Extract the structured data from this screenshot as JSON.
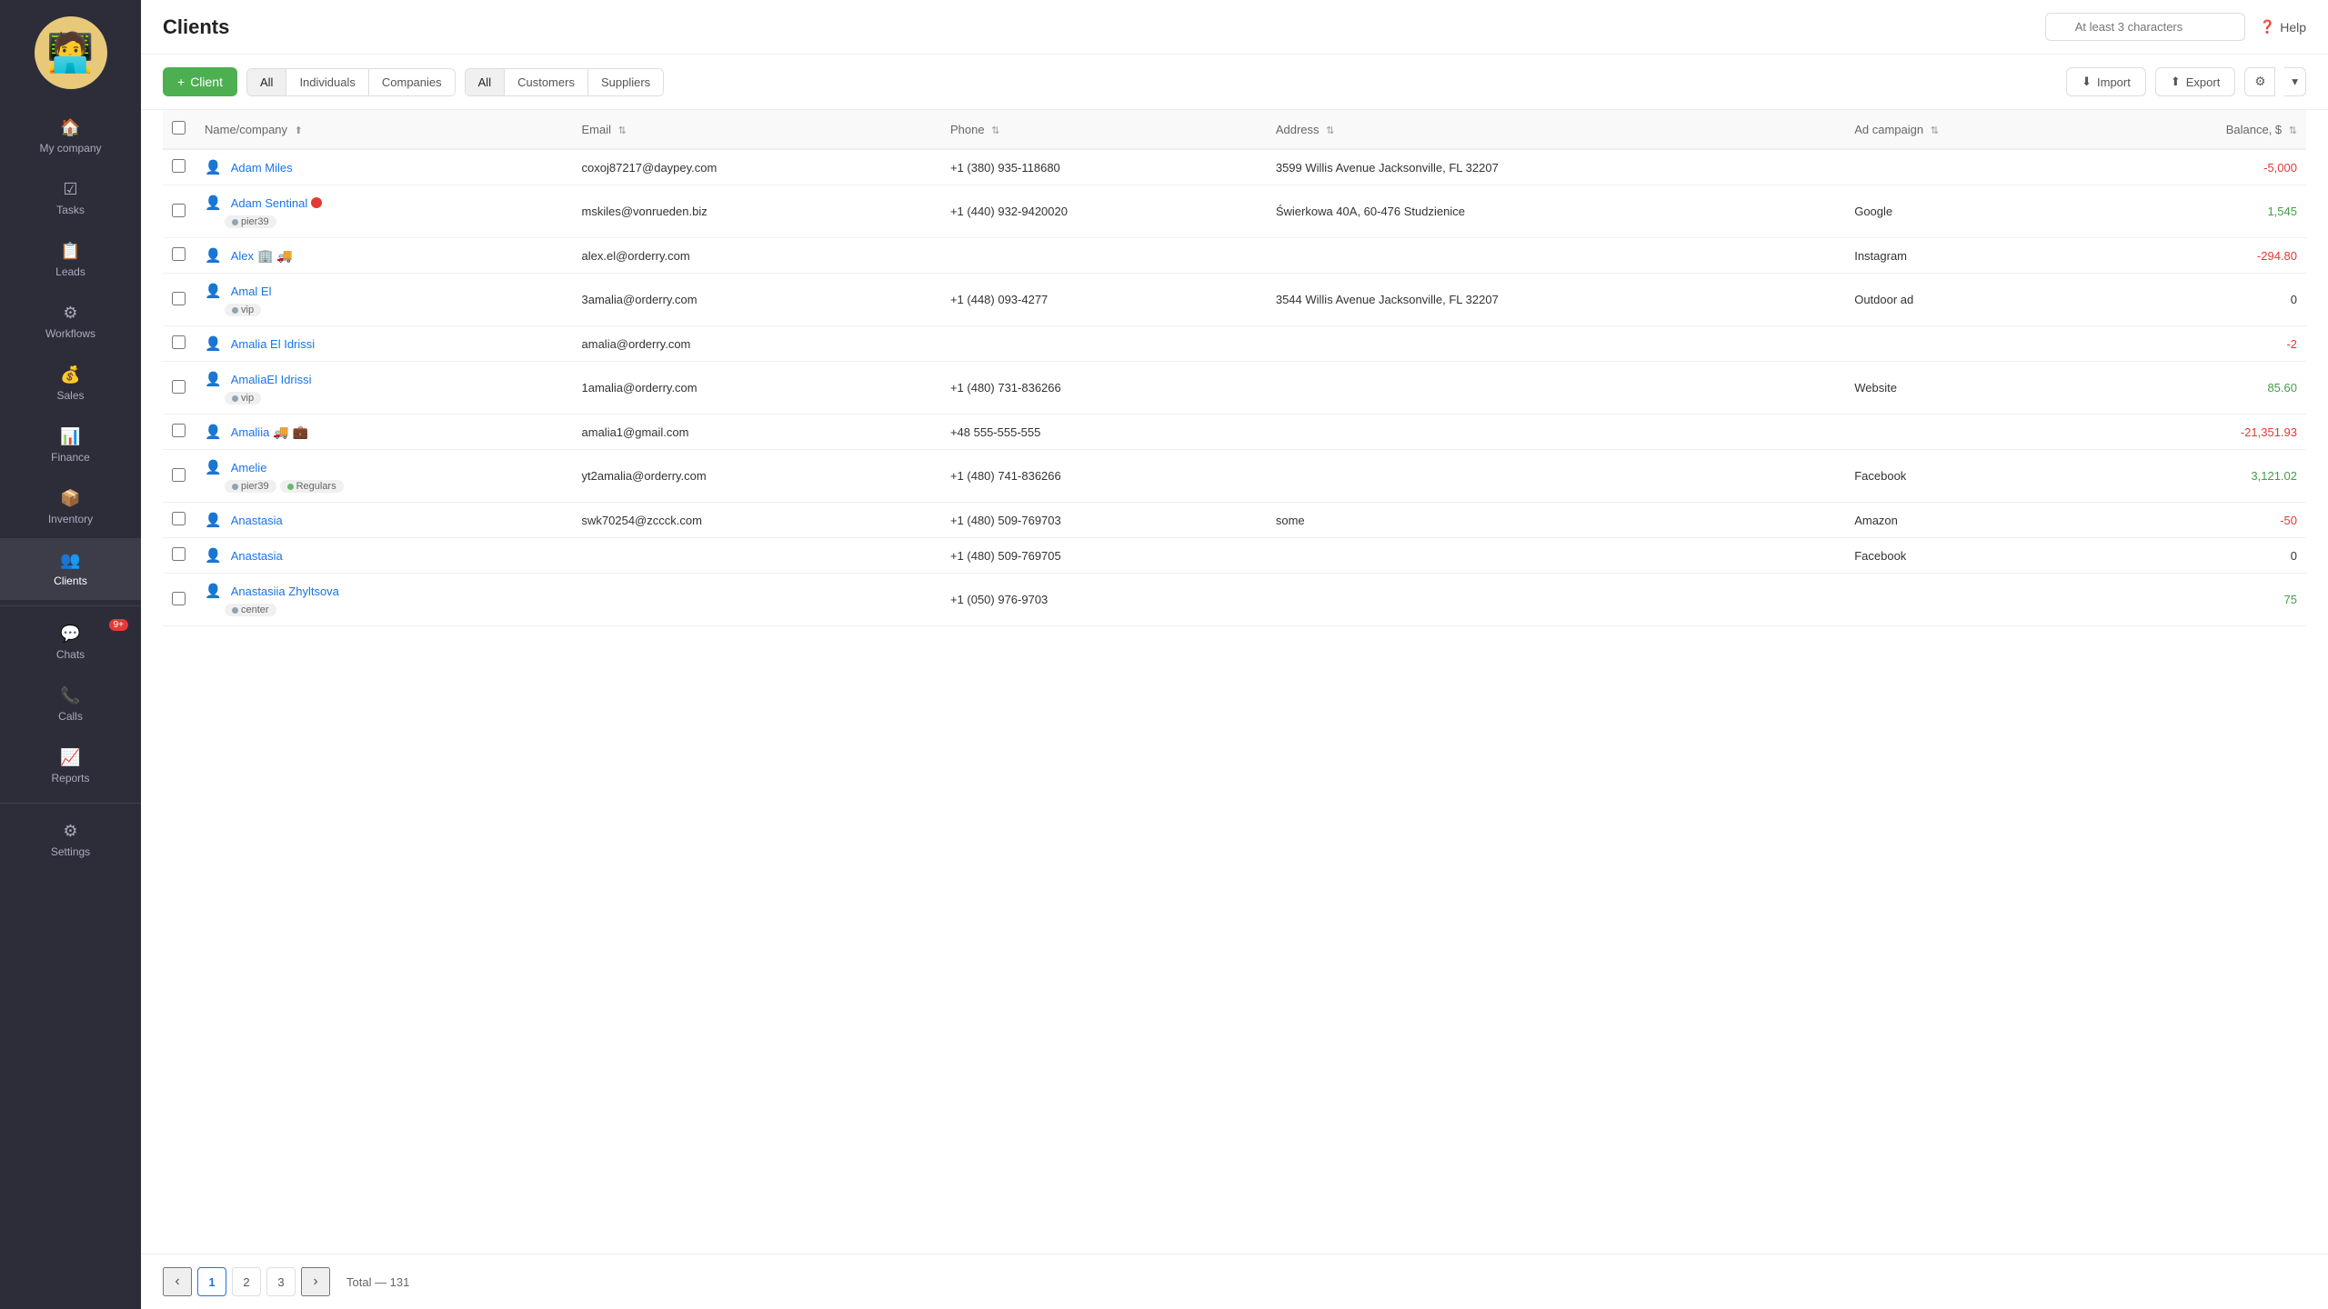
{
  "sidebar": {
    "items": [
      {
        "id": "my-company",
        "label": "My company",
        "icon": "🏠"
      },
      {
        "id": "tasks",
        "label": "Tasks",
        "icon": "✓"
      },
      {
        "id": "leads",
        "label": "Leads",
        "icon": "📋"
      },
      {
        "id": "workflows",
        "label": "Workflows",
        "icon": "⚙"
      },
      {
        "id": "sales",
        "label": "Sales",
        "icon": "💰"
      },
      {
        "id": "finance",
        "label": "Finance",
        "icon": "📊"
      },
      {
        "id": "inventory",
        "label": "Inventory",
        "icon": "📦"
      },
      {
        "id": "clients",
        "label": "Clients",
        "icon": "👥",
        "active": true
      },
      {
        "id": "chats",
        "label": "Chats",
        "icon": "💬",
        "badge": "9+"
      },
      {
        "id": "calls",
        "label": "Calls",
        "icon": "📞"
      },
      {
        "id": "reports",
        "label": "Reports",
        "icon": "📈"
      },
      {
        "id": "settings",
        "label": "Settings",
        "icon": "⚙"
      }
    ]
  },
  "header": {
    "title": "Clients",
    "search_placeholder": "At least 3 characters",
    "help_label": "Help"
  },
  "toolbar": {
    "add_button": "+ Client",
    "filter_groups": {
      "type_filters": [
        "All",
        "Individuals",
        "Companies"
      ],
      "role_filters": [
        "All",
        "Customers",
        "Suppliers"
      ]
    },
    "import_label": "Import",
    "export_label": "Export"
  },
  "table": {
    "columns": [
      {
        "id": "name",
        "label": "Name/company",
        "sortable": true
      },
      {
        "id": "email",
        "label": "Email",
        "sortable": true
      },
      {
        "id": "phone",
        "label": "Phone",
        "sortable": true
      },
      {
        "id": "address",
        "label": "Address",
        "sortable": true
      },
      {
        "id": "ad_campaign",
        "label": "Ad campaign",
        "sortable": true
      },
      {
        "id": "balance",
        "label": "Balance, $",
        "sortable": true
      }
    ],
    "rows": [
      {
        "id": 1,
        "name": "Adam Miles",
        "type": "individual",
        "email": "coxoj87217@daypey.com",
        "phone": "+1 (380) 935-118680",
        "address": "3599 Willis Avenue Jacksonville, FL 32207",
        "ad_campaign": "",
        "balance": "-5,000",
        "balance_type": "negative",
        "tags": [],
        "extra_icons": []
      },
      {
        "id": 2,
        "name": "Adam Sentinal",
        "type": "individual",
        "email": "mskiles@vonrueden.biz",
        "phone": "+1 (440) 932-9420020",
        "address": "Świerkowa 40A, 60-476 Studzienice",
        "ad_campaign": "Google",
        "balance": "1,545",
        "balance_type": "positive",
        "tags": [
          "pier39"
        ],
        "extra_icons": [
          "status-red"
        ],
        "tag_colors": [
          "gray"
        ]
      },
      {
        "id": 3,
        "name": "Alex",
        "type": "individual",
        "email": "alex.el@orderry.com",
        "phone": "",
        "address": "",
        "ad_campaign": "Instagram",
        "balance": "-294.80",
        "balance_type": "negative",
        "tags": [],
        "extra_icons": [
          "building",
          "truck"
        ]
      },
      {
        "id": 4,
        "name": "Amal El",
        "type": "individual",
        "email": "3amalia@orderry.com",
        "phone": "+1 (448) 093-4277",
        "address": "3544 Willis Avenue Jacksonville, FL 32207",
        "ad_campaign": "Outdoor ad",
        "balance": "0",
        "balance_type": "zero",
        "tags": [
          "vip"
        ],
        "tag_colors": [
          "gray"
        ]
      },
      {
        "id": 5,
        "name": "Amalia El Idrissi",
        "type": "individual",
        "email": "amalia@orderry.com",
        "phone": "",
        "address": "",
        "ad_campaign": "",
        "balance": "-2",
        "balance_type": "negative",
        "tags": [],
        "extra_icons": []
      },
      {
        "id": 6,
        "name": "AmaliaEl Idrissi",
        "type": "individual",
        "email": "1amalia@orderry.com",
        "phone": "+1 (480) 731-836266",
        "address": "",
        "ad_campaign": "Website",
        "balance": "85.60",
        "balance_type": "positive",
        "tags": [
          "vip"
        ],
        "tag_colors": [
          "gray"
        ]
      },
      {
        "id": 7,
        "name": "Amaliia",
        "type": "individual",
        "email": "amalia1@gmail.com",
        "phone": "+48 555-555-555",
        "address": "",
        "ad_campaign": "",
        "balance": "-21,351.93",
        "balance_type": "negative",
        "tags": [],
        "extra_icons": [
          "briefcase",
          "truck2"
        ]
      },
      {
        "id": 8,
        "name": "Amelie",
        "type": "individual",
        "email": "yt2amalia@orderry.com",
        "phone": "+1 (480) 741-836266",
        "address": "",
        "ad_campaign": "Facebook",
        "balance": "3,121.02",
        "balance_type": "positive",
        "tags": [
          "pier39",
          "Regulars"
        ],
        "tag_colors": [
          "gray",
          "green"
        ]
      },
      {
        "id": 9,
        "name": "Anastasia",
        "type": "individual",
        "email": "swk70254@zccck.com",
        "phone": "+1 (480) 509-769703",
        "address": "some",
        "ad_campaign": "Amazon",
        "balance": "-50",
        "balance_type": "negative",
        "tags": [],
        "extra_icons": []
      },
      {
        "id": 10,
        "name": "Anastasia",
        "type": "individual",
        "email": "",
        "phone": "+1 (480) 509-769705",
        "address": "",
        "ad_campaign": "Facebook",
        "balance": "0",
        "balance_type": "zero",
        "tags": [],
        "extra_icons": []
      },
      {
        "id": 11,
        "name": "Anastasiia Zhyltsova",
        "type": "individual",
        "email": "",
        "phone": "+1 (050) 976-9703",
        "address": "",
        "ad_campaign": "",
        "balance": "75",
        "balance_type": "positive",
        "tags": [
          "center"
        ],
        "tag_colors": [
          "gray"
        ]
      }
    ]
  },
  "pagination": {
    "current_page": 1,
    "pages": [
      1,
      2,
      3
    ],
    "total_label": "Total — 131"
  }
}
